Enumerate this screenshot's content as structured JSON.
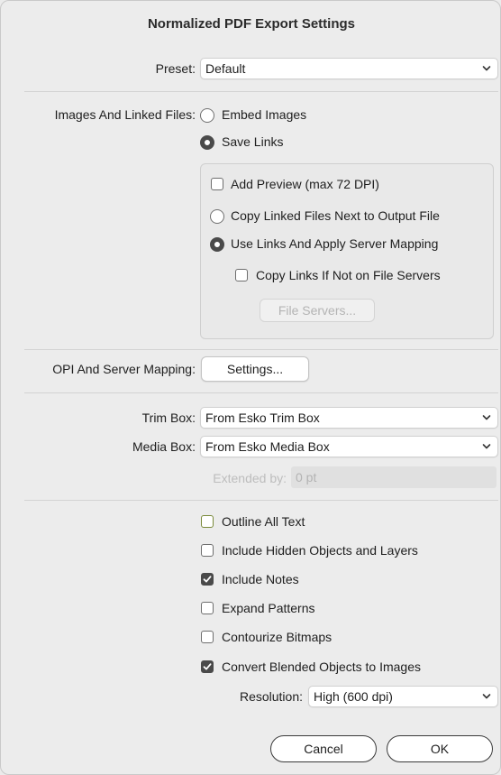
{
  "dialog": {
    "title": "Normalized PDF Export Settings"
  },
  "preset": {
    "label": "Preset:",
    "value": "Default"
  },
  "images": {
    "label": "Images And Linked Files:",
    "embed_label": "Embed Images",
    "save_links_label": "Save Links",
    "embed_selected": false,
    "save_links_selected": true,
    "add_preview_label": "Add Preview (max 72 DPI)",
    "add_preview_checked": false,
    "copy_linked_label": "Copy Linked Files Next to Output File",
    "copy_linked_selected": false,
    "use_links_label": "Use Links And Apply Server Mapping",
    "use_links_selected": true,
    "copy_if_not_label": "Copy Links If Not on File Servers",
    "copy_if_not_checked": false,
    "file_servers_button": "File Servers..."
  },
  "opi": {
    "label": "OPI And Server Mapping:",
    "settings_button": "Settings..."
  },
  "trim_box": {
    "label": "Trim Box:",
    "value": "From Esko Trim Box"
  },
  "media_box": {
    "label": "Media Box:",
    "value": "From Esko Media Box"
  },
  "extended": {
    "label": "Extended by:",
    "value": "0 pt"
  },
  "options": {
    "outline_text": {
      "label": "Outline All Text",
      "checked": false
    },
    "hidden_objects": {
      "label": "Include Hidden Objects and Layers",
      "checked": false
    },
    "include_notes": {
      "label": "Include Notes",
      "checked": true
    },
    "expand_patterns": {
      "label": "Expand Patterns",
      "checked": false
    },
    "contourize": {
      "label": "Contourize Bitmaps",
      "checked": false
    },
    "convert_blended": {
      "label": "Convert Blended Objects to Images",
      "checked": true
    }
  },
  "resolution": {
    "label": "Resolution:",
    "value": "High (600 dpi)"
  },
  "buttons": {
    "cancel": "Cancel",
    "ok": "OK"
  },
  "icons": {
    "dropdown": "chevron-down-icon",
    "check": "checkmark-icon"
  },
  "colors": {
    "background": "#ececec",
    "control_fill": "#4a4a4a",
    "outline_checkbox": "#7a8a3a"
  }
}
